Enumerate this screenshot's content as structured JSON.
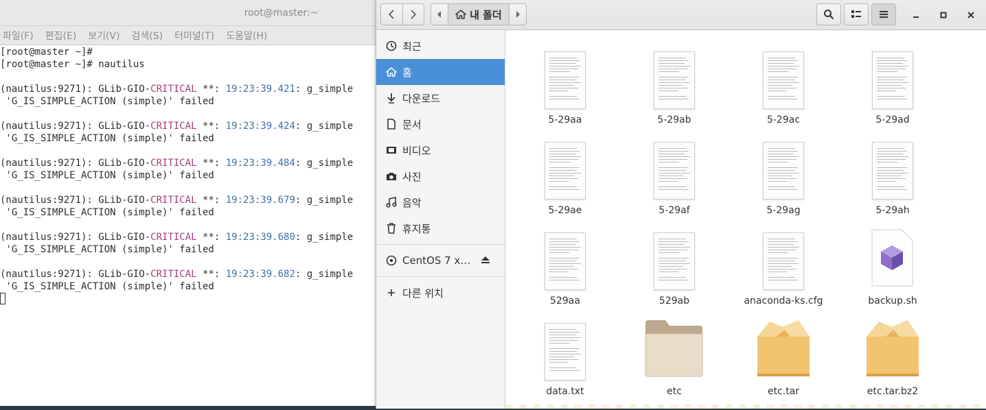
{
  "terminal": {
    "title": "root@master:~",
    "menu": [
      "파일(F)",
      "편집(E)",
      "보기(V)",
      "검색(S)",
      "터미널(T)",
      "도움말(H)"
    ],
    "prompt_lines": [
      "[root@master ~]#",
      "[root@master ~]# nautilus"
    ],
    "log_entries": [
      {
        "prefix": "(nautilus:9271): GLib-GIO-",
        "level": "CRITICAL",
        "stars": " **: ",
        "time": "19:23:39.421",
        "msg": ": g_simple",
        "cont": " 'G_IS_SIMPLE_ACTION (simple)' failed"
      },
      {
        "prefix": "(nautilus:9271): GLib-GIO-",
        "level": "CRITICAL",
        "stars": " **: ",
        "time": "19:23:39.424",
        "msg": ": g_simple",
        "cont": " 'G_IS_SIMPLE_ACTION (simple)' failed"
      },
      {
        "prefix": "(nautilus:9271): GLib-GIO-",
        "level": "CRITICAL",
        "stars": " **: ",
        "time": "19:23:39.484",
        "msg": ": g_simple",
        "cont": " 'G_IS_SIMPLE_ACTION (simple)' failed"
      },
      {
        "prefix": "(nautilus:9271): GLib-GIO-",
        "level": "CRITICAL",
        "stars": " **: ",
        "time": "19:23:39.679",
        "msg": ": g_simple",
        "cont": " 'G_IS_SIMPLE_ACTION (simple)' failed"
      },
      {
        "prefix": "(nautilus:9271): GLib-GIO-",
        "level": "CRITICAL",
        "stars": " **: ",
        "time": "19:23:39.680",
        "msg": ": g_simple",
        "cont": " 'G_IS_SIMPLE_ACTION (simple)' failed"
      },
      {
        "prefix": "(nautilus:9271): GLib-GIO-",
        "level": "CRITICAL",
        "stars": " **: ",
        "time": "19:23:39.682",
        "msg": ": g_simple",
        "cont": " 'G_IS_SIMPLE_ACTION (simple)' failed"
      }
    ]
  },
  "files_window": {
    "path_current": "내 폴더",
    "sidebar": {
      "items": [
        {
          "label": "최근",
          "icon": "clock-icon"
        },
        {
          "label": "홈",
          "icon": "home-icon",
          "active": true
        },
        {
          "label": "다운로드",
          "icon": "download-icon"
        },
        {
          "label": "문서",
          "icon": "document-icon"
        },
        {
          "label": "비디오",
          "icon": "video-icon"
        },
        {
          "label": "사진",
          "icon": "camera-icon"
        },
        {
          "label": "음악",
          "icon": "music-icon"
        },
        {
          "label": "휴지통",
          "icon": "trash-icon"
        }
      ],
      "device": {
        "label": "CentOS 7 x…",
        "icon": "disc-icon",
        "action_icon": "eject-icon"
      },
      "other": {
        "label": "다른 위치",
        "icon": "plus-icon"
      }
    },
    "files": [
      {
        "name": "5-29aa",
        "type": "text"
      },
      {
        "name": "5-29ab",
        "type": "text"
      },
      {
        "name": "5-29ac",
        "type": "text"
      },
      {
        "name": "5-29ad",
        "type": "text"
      },
      {
        "name": "5-29ae",
        "type": "text"
      },
      {
        "name": "5-29af",
        "type": "text"
      },
      {
        "name": "5-29ag",
        "type": "text"
      },
      {
        "name": "5-29ah",
        "type": "text"
      },
      {
        "name": "529aa",
        "type": "text"
      },
      {
        "name": "529ab",
        "type": "text"
      },
      {
        "name": "anaconda-ks.cfg",
        "type": "text"
      },
      {
        "name": "backup.sh",
        "type": "script"
      },
      {
        "name": "data.txt",
        "type": "text"
      },
      {
        "name": "etc",
        "type": "folder"
      },
      {
        "name": "etc.tar",
        "type": "archive"
      },
      {
        "name": "etc.tar.bz2",
        "type": "archive"
      }
    ],
    "colors": {
      "accent": "#4a90d9",
      "critical": "#a0407e",
      "timestamp": "#3c6fa8"
    }
  }
}
